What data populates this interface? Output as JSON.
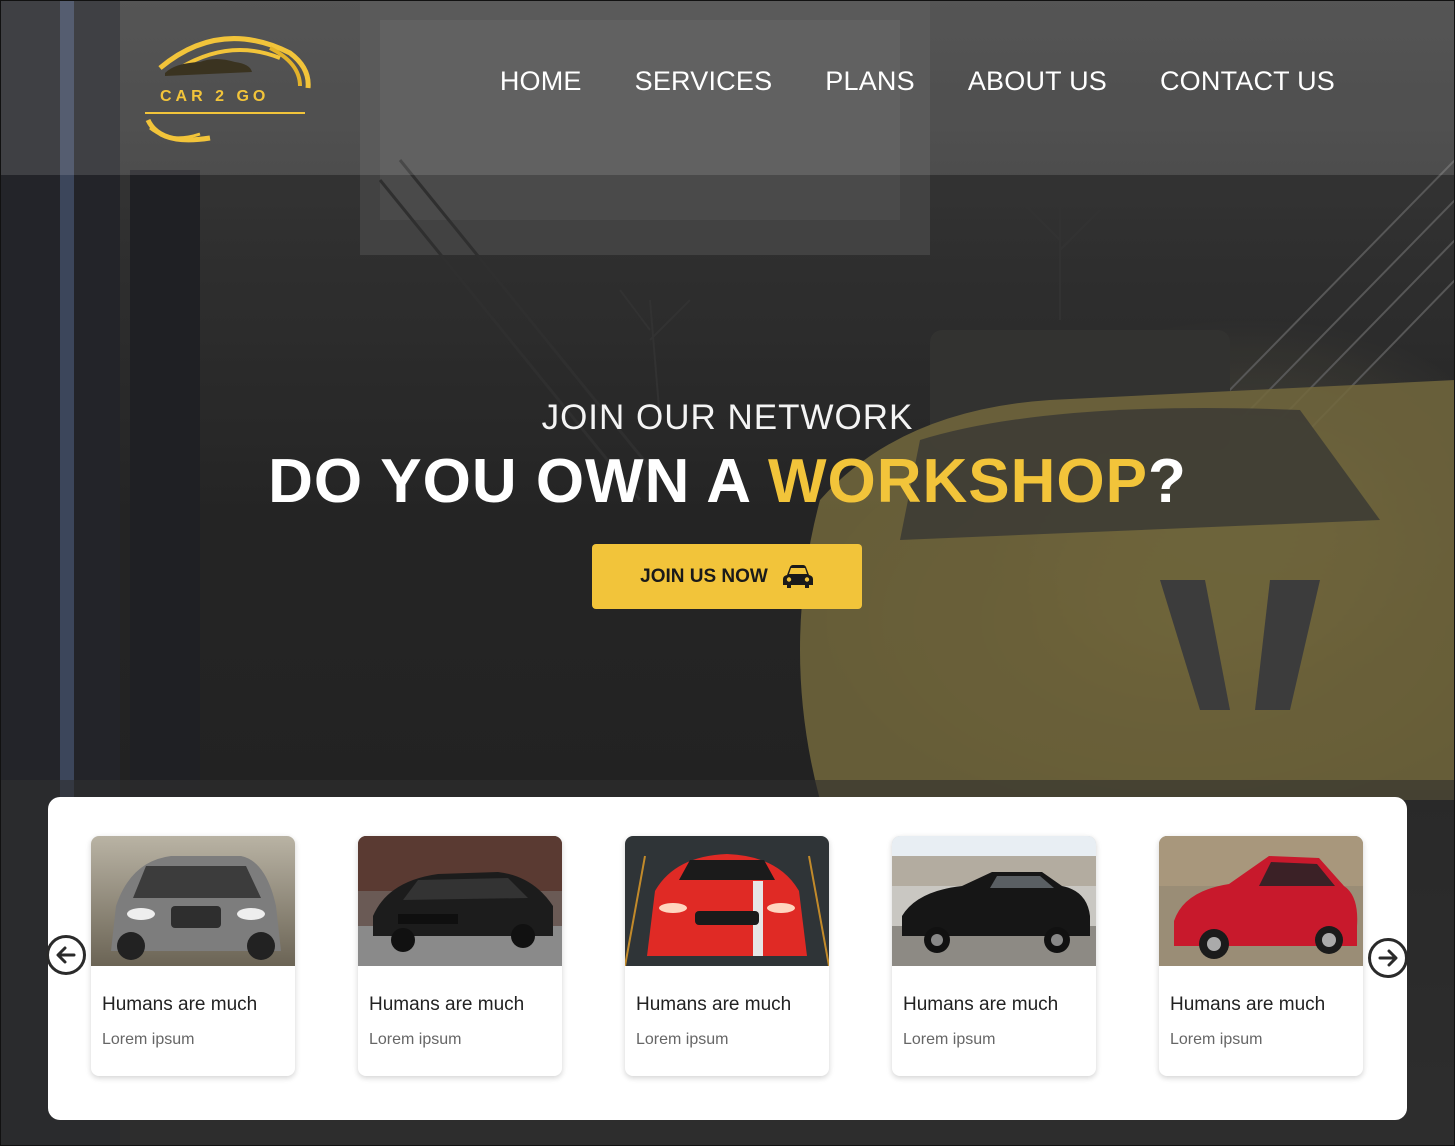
{
  "brand": {
    "logo_text": "CAR 2 GO",
    "accent_color": "#f2c43a"
  },
  "nav": {
    "items": [
      {
        "label": "HOME"
      },
      {
        "label": "SERVICES"
      },
      {
        "label": "PLANS"
      },
      {
        "label": "ABOUT US"
      },
      {
        "label": "CONTACT US"
      }
    ]
  },
  "hero": {
    "eyebrow": "JOIN OUR NETWORK",
    "headline_start": "DO YOU OWN A ",
    "headline_accent": "WORKSHOP",
    "headline_end": "?",
    "cta_label": "JOIN US NOW",
    "cta_icon": "car-icon"
  },
  "carousel": {
    "prev_icon": "arrow-left-circle-icon",
    "next_icon": "arrow-right-circle-icon",
    "cards": [
      {
        "title": "Humans are much",
        "subtitle": "Lorem ipsum",
        "image": "silver-suv-photo"
      },
      {
        "title": "Humans are much",
        "subtitle": "Lorem ipsum",
        "image": "black-sedan-photo"
      },
      {
        "title": "Humans are much",
        "subtitle": "Lorem ipsum",
        "image": "red-sports-car-photo"
      },
      {
        "title": "Humans are much",
        "subtitle": "Lorem ipsum",
        "image": "black-muscle-car-photo"
      },
      {
        "title": "Humans are much",
        "subtitle": "Lorem ipsum",
        "image": "red-coupe-photo"
      }
    ]
  }
}
